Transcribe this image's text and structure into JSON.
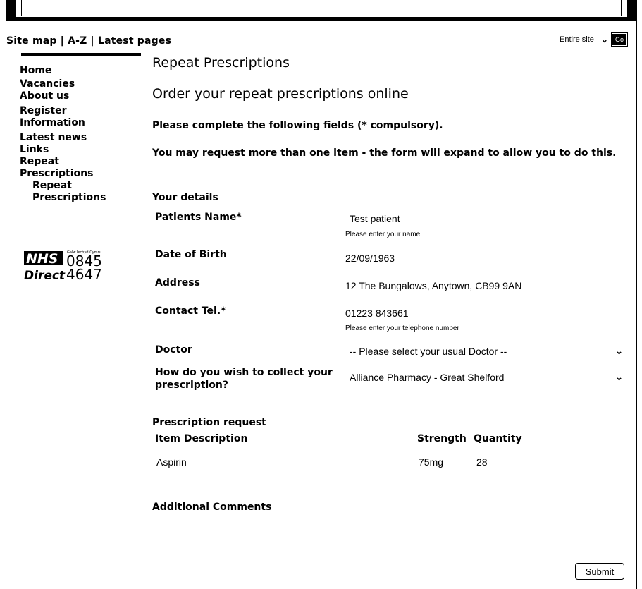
{
  "header": {
    "links": [
      "Site map",
      "A-Z",
      "Latest pages"
    ],
    "separator": " | ",
    "search": {
      "scope": "Entire site",
      "go_label": "Go"
    }
  },
  "sidebar": {
    "items": [
      {
        "label": "Home"
      },
      {
        "label": "Vacancies"
      },
      {
        "label": "About us"
      },
      {
        "label": "Register"
      },
      {
        "label": "Information"
      },
      {
        "label": "Latest news"
      },
      {
        "label": "Links"
      },
      {
        "label": "Repeat Prescriptions"
      }
    ],
    "sub_item": "Repeat Prescriptions",
    "nhs_logo": {
      "brand": "NHS",
      "line2": "Direct",
      "number_top": "0845",
      "number_bottom": "4647",
      "tiny": "Galw Iechyd Cymru"
    }
  },
  "main": {
    "page_title": "Repeat Prescriptions",
    "heading": "Order your repeat prescriptions online",
    "intro": "Please complete the following fields (* compulsory).",
    "note": "You may request more than one item - the form will expand to allow you to do this.",
    "your_details": "Your details",
    "fields": {
      "patient_name_label": "Patients Name*",
      "patient_name_value": "Test patient",
      "patient_name_hint": "Please enter your name",
      "dob_label": "Date of Birth",
      "dob_value": "22/09/1963",
      "address_label": "Address",
      "address_value": "12 The Bungalows, Anytown, CB99 9AN",
      "tel_label": "Contact Tel.*",
      "tel_value": "01223 843661",
      "tel_hint": "Please enter your telephone number",
      "doctor_label": "Doctor",
      "doctor_value": "-- Please select your usual Doctor --",
      "collect_label": "How do you wish to collect your prescription?",
      "collect_value": "Alliance Pharmacy - Great Shelford"
    },
    "prescription_request": "Prescription request",
    "table": {
      "headers": {
        "item": "Item Description",
        "strength": "Strength",
        "quantity": "Quantity"
      },
      "rows": [
        {
          "item": "Aspirin",
          "strength": "75mg",
          "quantity": "28"
        }
      ]
    },
    "additional_comments": "Additional Comments",
    "submit_label": "Submit"
  }
}
